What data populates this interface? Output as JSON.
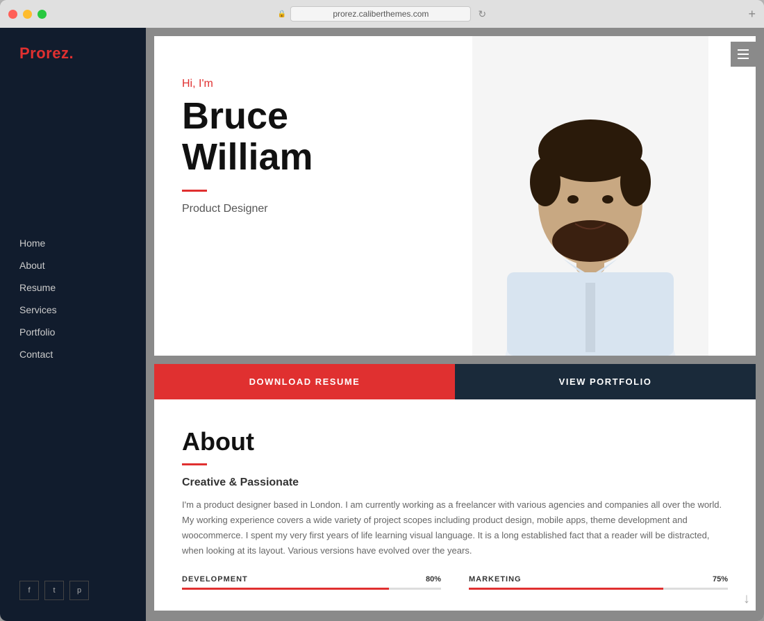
{
  "window": {
    "title": "prorez.caliberthemes.com",
    "url": "prorez.caliberthemes.com"
  },
  "sidebar": {
    "logo": "Prorez",
    "logo_dot": ".",
    "nav_items": [
      {
        "label": "Home",
        "id": "home"
      },
      {
        "label": "About",
        "id": "about"
      },
      {
        "label": "Resume",
        "id": "resume"
      },
      {
        "label": "Services",
        "id": "services"
      },
      {
        "label": "Portfolio",
        "id": "portfolio"
      },
      {
        "label": "Contact",
        "id": "contact"
      }
    ],
    "social": [
      {
        "icon": "f",
        "name": "facebook"
      },
      {
        "icon": "t",
        "name": "twitter"
      },
      {
        "icon": "p",
        "name": "pinterest"
      }
    ]
  },
  "hero": {
    "greeting": "Hi, I'm",
    "first_name": "Bruce",
    "last_name": "William",
    "job_title": "Product Designer",
    "download_label": "DOWNLOAD RESUME",
    "portfolio_label": "VIEW PORTFOLIO"
  },
  "about": {
    "title": "About",
    "subtitle": "Creative & Passionate",
    "body": "I'm a product designer based in London. I am currently working as a freelancer with various agencies and companies all over the world. My working experience covers a wide variety of project scopes including product design, mobile apps, theme development and woocommerce. I spent my very first years of life learning visual language. It is a long established fact that a reader will be distracted, when looking at its layout. Various versions have evolved over the years.",
    "skills": [
      {
        "name": "DEVELOPMENT",
        "pct": 80,
        "label": "80%"
      },
      {
        "name": "MARKETING",
        "pct": 75,
        "label": "75%"
      }
    ]
  },
  "colors": {
    "accent": "#e03030",
    "dark_navy": "#1a2a3a",
    "sidebar_bg": "#111c2d"
  }
}
